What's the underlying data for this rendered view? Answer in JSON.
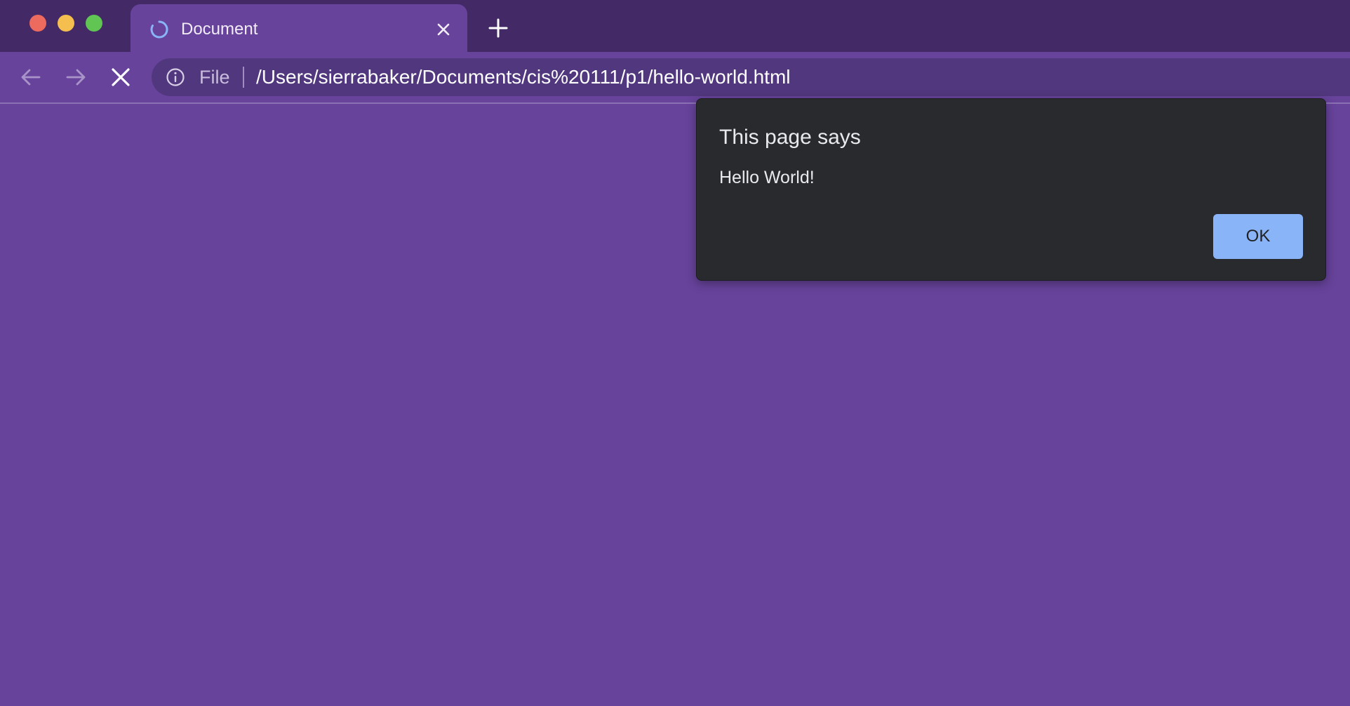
{
  "colors": {
    "frame": "#432a66",
    "theme": "#67439b",
    "omnibox": "#51377d",
    "dialog_bg": "#292a2d",
    "ok_button": "#8ab4f8",
    "traffic_close": "#ec6a5e",
    "traffic_minimize": "#f4bf4f",
    "traffic_maximize": "#61c554",
    "spinner": "#8ab4f8"
  },
  "window_controls": {
    "close_icon": "traffic-light-close",
    "minimize_icon": "traffic-light-minimize",
    "maximize_icon": "traffic-light-maximize"
  },
  "tab": {
    "title": "Document",
    "loading_icon": "loading-spinner-icon",
    "close_icon": "close-x-icon"
  },
  "new_tab_icon": "plus-icon",
  "toolbar": {
    "back_icon": "arrow-left-icon",
    "forward_icon": "arrow-right-icon",
    "stop_icon": "stop-x-icon"
  },
  "omnibox": {
    "info_icon": "info-circle-icon",
    "scheme": "File",
    "url": "/Users/sierrabaker/Documents/cis%20111/p1/hello-world.html"
  },
  "dialog": {
    "title": "This page says",
    "message": "Hello World!",
    "ok_label": "OK"
  }
}
